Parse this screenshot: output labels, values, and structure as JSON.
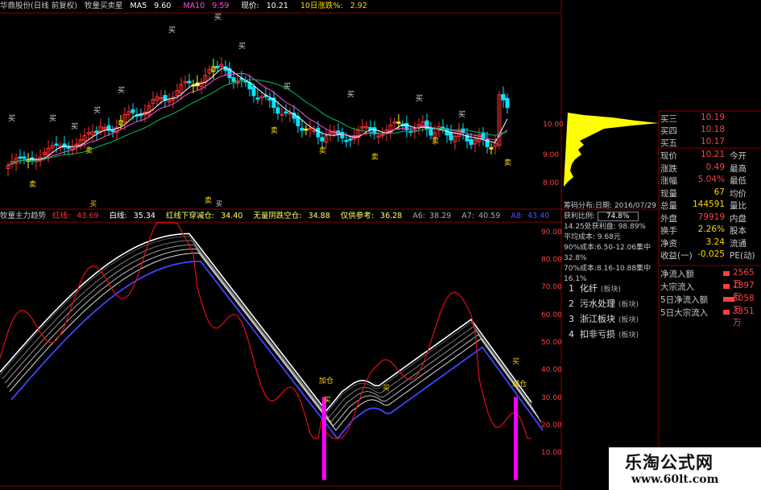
{
  "header": {
    "stock": "华鼎股份(日线 前复权)",
    "indicator": "牧童买卖星",
    "ma5_label": "MA5",
    "ma5_value": "9.60",
    "ma10_label": "MA10",
    "ma10_value": "9.59",
    "price_label": "现价:",
    "price_value": "10.21",
    "chg10_label": "10日涨跌%:",
    "chg10_value": "2.92"
  },
  "indicator_bar": {
    "name": "牧童主力趋势",
    "red_label": "红线:",
    "red_value": "43.69",
    "white_label": "白线:",
    "white_value": "35.34",
    "cross_label": "红线下穿减仓:",
    "cross_value": "34.40",
    "clear_label": "无量阴跌空仓:",
    "clear_value": "34.88",
    "ref_label": "仅供参考:",
    "ref_value": "36.28",
    "a6_label": "A6:",
    "a6_value": "38.29",
    "a7_label": "A7:",
    "a7_value": "40.59",
    "a8_label": "A8:",
    "a8_value": "43.40"
  },
  "price_axis": [
    "10.00",
    "9.00",
    "8.00"
  ],
  "ind_axis": [
    "90.00",
    "80.00",
    "70.00",
    "60.00",
    "50.00",
    "40.00",
    "30.00",
    "20.00",
    "10.00"
  ],
  "markers": {
    "buy": "买",
    "sell": "卖",
    "add": "加仓",
    "reduce": "减仓",
    "small_buy": "买"
  },
  "chips": {
    "date_label": "筹码分布:日期:",
    "date_value": "2016/07/29",
    "profit_label": "获利比例:",
    "profit_value": "74.8%",
    "profit_line": "14.25处获利盘: 98.89%",
    "avg_line": "平均成本: 9.68元",
    "c90_line": "90%成本:6.50-12.06集中32.8%",
    "c70_line": "70%成本:8.16-10.88集中16.1%"
  },
  "menu": [
    {
      "num": "1",
      "label": "化纤",
      "tag": "(板块)"
    },
    {
      "num": "2",
      "label": "污水处理",
      "tag": "(板块)"
    },
    {
      "num": "3",
      "label": "浙江板块",
      "tag": "(板块)"
    },
    {
      "num": "4",
      "label": "扣非亏损",
      "tag": "(板块)"
    }
  ],
  "quotes": {
    "ask3_label": "买三",
    "ask3": "10.19",
    "ask4_label": "买四",
    "ask4": "10.18",
    "ask5_label": "买五",
    "ask5": "10.17",
    "rows": [
      {
        "k": "现价",
        "v": "10.21",
        "k2": "今开",
        "color": "#ff4040"
      },
      {
        "k": "涨跌",
        "v": "0.49",
        "k2": "最高",
        "color": "#ff4040"
      },
      {
        "k": "涨幅",
        "v": "5.04%",
        "k2": "最低",
        "color": "#ff4040"
      },
      {
        "k": "现量",
        "v": "67",
        "k2": "均价",
        "color": "#ffd700"
      },
      {
        "k": "总量",
        "v": "144591",
        "k2": "量比",
        "color": "#ffd700"
      },
      {
        "k": "外盘",
        "v": "79919",
        "k2": "内盘",
        "color": "#ff4040"
      },
      {
        "k": "换手",
        "v": "2.26%",
        "k2": "股本",
        "color": "#ffd700"
      },
      {
        "k": "净资",
        "v": "3.24",
        "k2": "流通",
        "color": "#ffd700"
      },
      {
        "k": "收益(一)",
        "v": "-0.025",
        "k2": "PE(动)",
        "color": "#ffd700"
      }
    ]
  },
  "flows": [
    {
      "k": "净流入额",
      "v": "2565万"
    },
    {
      "k": "大宗流入",
      "v": "1897万"
    },
    {
      "k": "5日净流入额",
      "v": "5058万"
    },
    {
      "k": "5日大宗流入",
      "v": "3351万"
    }
  ],
  "watermark": {
    "title": "乐淘公式网",
    "url": "www.60lt.com"
  },
  "colors": {
    "up": "#ff3030",
    "down": "#00e5ff",
    "yellow": "#ffff00",
    "magenta": "#ff00ff",
    "blue": "#3d45ff",
    "white": "#ffffff"
  }
}
